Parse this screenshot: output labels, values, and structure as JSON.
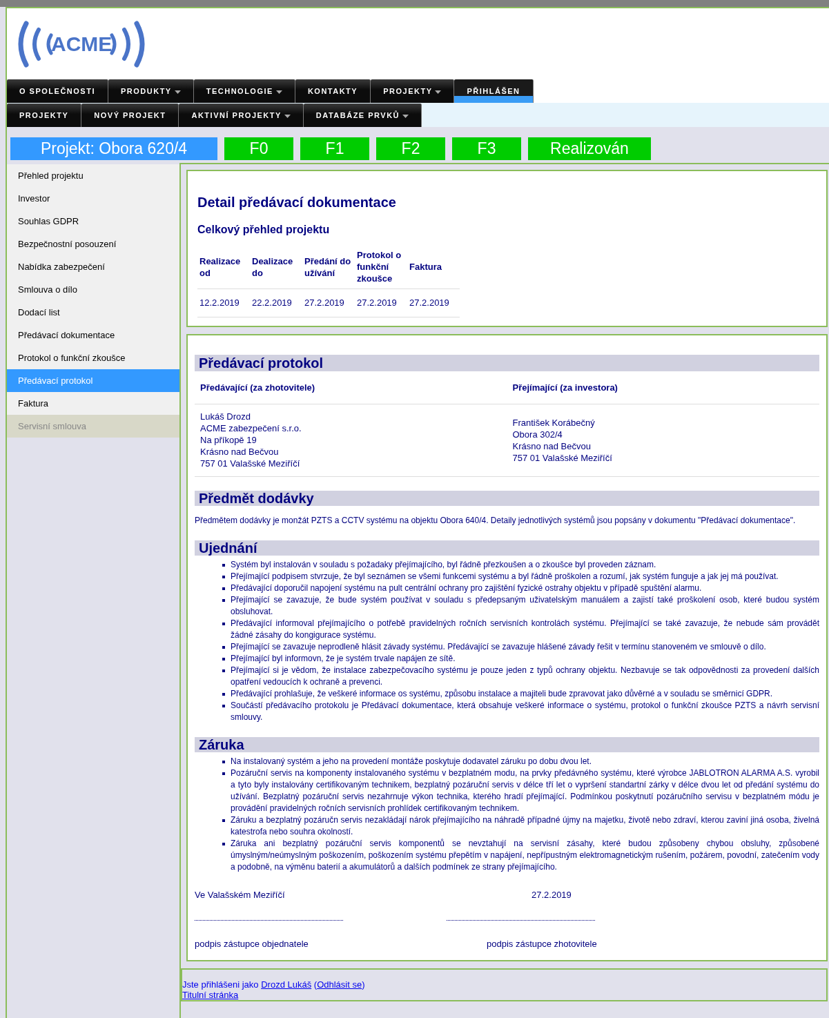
{
  "logo": {
    "text": "ACME"
  },
  "nav_primary": [
    {
      "label": "O SPOLEČNOSTI",
      "has_caret": false,
      "selected": false
    },
    {
      "label": "PRODUKTY",
      "has_caret": true,
      "selected": false
    },
    {
      "label": "TECHNOLOGIE",
      "has_caret": true,
      "selected": false
    },
    {
      "label": "KONTAKTY",
      "has_caret": false,
      "selected": false
    },
    {
      "label": "PROJEKTY",
      "has_caret": true,
      "selected": false
    },
    {
      "label": "PŘIHLÁŠEN",
      "has_caret": false,
      "selected": true
    }
  ],
  "nav_secondary": [
    {
      "label": "PROJEKTY",
      "has_caret": false
    },
    {
      "label": "NOVÝ PROJEKT",
      "has_caret": false
    },
    {
      "label": "AKTIVNÍ PROJEKTY",
      "has_caret": true
    },
    {
      "label": "DATABÁZE PRVKŮ",
      "has_caret": true
    }
  ],
  "project_bar": {
    "title": "Projekt: Obora 620/4",
    "stages": [
      "F0",
      "F1",
      "F2",
      "F3",
      "Realizován"
    ]
  },
  "sidebar": {
    "items": [
      {
        "label": "Přehled projektu",
        "selected": false,
        "disabled": false
      },
      {
        "label": "Investor",
        "selected": false,
        "disabled": false
      },
      {
        "label": "Souhlas GDPR",
        "selected": false,
        "disabled": false
      },
      {
        "label": "Bezpečnostní posouzení",
        "selected": false,
        "disabled": false
      },
      {
        "label": "Nabídka zabezpečení",
        "selected": false,
        "disabled": false
      },
      {
        "label": "Smlouva o dílo",
        "selected": false,
        "disabled": false
      },
      {
        "label": "Dodací list",
        "selected": false,
        "disabled": false
      },
      {
        "label": "Předávací dokumentace",
        "selected": false,
        "disabled": false
      },
      {
        "label": "Protokol o funkční zkoušce",
        "selected": false,
        "disabled": false
      },
      {
        "label": "Předávací protokol",
        "selected": true,
        "disabled": false
      },
      {
        "label": "Faktura",
        "selected": false,
        "disabled": false
      },
      {
        "label": "Servisní smlouva",
        "selected": false,
        "disabled": true
      }
    ]
  },
  "summary": {
    "title": "Detail předávací dokumentace",
    "subtitle": "Celkový přehled projektu",
    "columns": [
      "Realizace od",
      "Dealizace do",
      "Předání do užívání",
      "Protokol o funkční zkoušce",
      "Faktura"
    ],
    "rows": [
      [
        "12.2.2019",
        "22.2.2019",
        "27.2.2019",
        "27.2.2019",
        "27.2.2019"
      ]
    ]
  },
  "protocol": {
    "title": "Předávací protokol",
    "parties": [
      {
        "heading": "Předávající (za zhotovitele)",
        "lines": [
          "Lukáš Drozd",
          "ACME zabezpečení s.r.o.",
          "Na příkopě 19",
          "Krásno nad Bečvou",
          "757 01 Valašské Meziříčí"
        ]
      },
      {
        "heading": "Přejímající (za investora)",
        "lines": [
          "František Korábečný",
          "Obora 302/4",
          "Krásno nad Bečvou",
          "757 01 Valašské Meziříčí"
        ]
      }
    ],
    "sections": [
      {
        "kind": "paragraph",
        "title": "Předmět dodávky",
        "text": "Předmětem dodávky je monžát PZTS a CCTV systému na objektu Obora 640/4. Detaily jednotlivých systémů jsou popsány v dokumentu \"Předávací dokumentace\"."
      },
      {
        "kind": "bullets",
        "title": "Ujednání",
        "items": [
          "Systém byl instalován v souladu s požadaky přejímajícího, byl řádně přezkoušen a o zkoušce byl proveden záznam.",
          "Přejímající podpisem stvrzuje, že byl seznámen se všemi funkcemi systému a byl řádně proškolen a rozumí, jak systém funguje a jak jej má používat.",
          "Předávající doporučil napojení systému na pult centrální ochrany pro zajištění fyzické ostrahy objektu v případě spuštění alarmu.",
          "Přejímající se zavazuje, že bude systém používat v souladu s předepsaným uživatelským manuálem a zajistí také proškolení osob, které budou systém obsluhovat.",
          "Předávající informoval přejímajícího o potřebě pravidelných ročních servisních kontrolách systému. Přejímající se také zavazuje, že nebude sám provádět žádné zásahy do kongigurace systému.",
          "Přejímající se zavazuje neprodleně hlásit závady systému. Předávající se zavazuje hlášené závady řešit v termínu stanoveném ve smlouvě o dílo.",
          "Přejímající byl informovn, že je systém trvale napájen ze sítě.",
          "Přejímající si je vědom, že instalace zabezpečovacího systému je pouze jeden z typů ochrany objektu. Nezbavuje se tak odpovědnosti za provedení dalších opatření vedoucích k ochraně a prevenci.",
          "Předávající prohlašuje, že veškeré informace os systému, způsobu instalace a majiteli bude zpravovat jako důvěrné a v souladu se směrnicí GDPR.",
          "Součástí předávacího protokolu je Předávací dokumentace, která obsahuje veškeré informace o systému, protokol o funkční zkoušce PZTS a návrh servisní smlouvy."
        ]
      },
      {
        "kind": "bullets",
        "title": "Záruka",
        "items": [
          "Na instalovaný systém a jeho na provedení montáže poskytuje dodavatel záruku po dobu dvou let.",
          "Pozáruční servis na komponenty instalovaného systému v bezplatném modu, na prvky předávného systému, které výrobce JABLOTRON ALARMA A.S. vyrobil a tyto byly instalovány certifikovaným technikem, bezplatný pozáruční servis v délce tří let o vypršení standartní zárky v délce dvou let od předání systému do užívání. Bezplatný pozáruční servis nezahrnuje výkon technika, kterého hradí přejímající. Podmínkou poskytnutí pozáručního servisu v bezplatném módu je provádění pravidelných ročních servisních prohlídek certifikovaným technikem.",
          "Záruku a bezplatný pozáručn servis nezakládají nárok přejímajícího na náhradě případné újmy na majetku, životě nebo zdraví, kterou zaviní jiná osoba, živelná katestrofa nebo souhra okolností.",
          "Záruka ani bezplatný pozáruční servis komponentů se nevztahují na servisní zásahy, které budou způsobeny chybou obsluhy, způsobené úmyslným/neúmyslným poškozením, poškozením systému přepětím v napájení, nepřípustným elektromagnetickým rušením, požárem, povodní, zatečením vody a podobně, na výměnu baterií a akumulátorů a dalších podmínek ze strany přejímajícího."
        ]
      }
    ],
    "place": "Ve Valašském Meziříčí",
    "date": "27.2.2019",
    "signatures": [
      "podpis zástupce objednatele",
      "podpis zástupce zhotovitele"
    ]
  },
  "footer": {
    "prefix": "Jste přihlášeni jako",
    "user": "Drozd Lukáš",
    "open": "(",
    "logout": "Odhlásit se",
    "close": ")",
    "home": "Titulní stránka"
  }
}
